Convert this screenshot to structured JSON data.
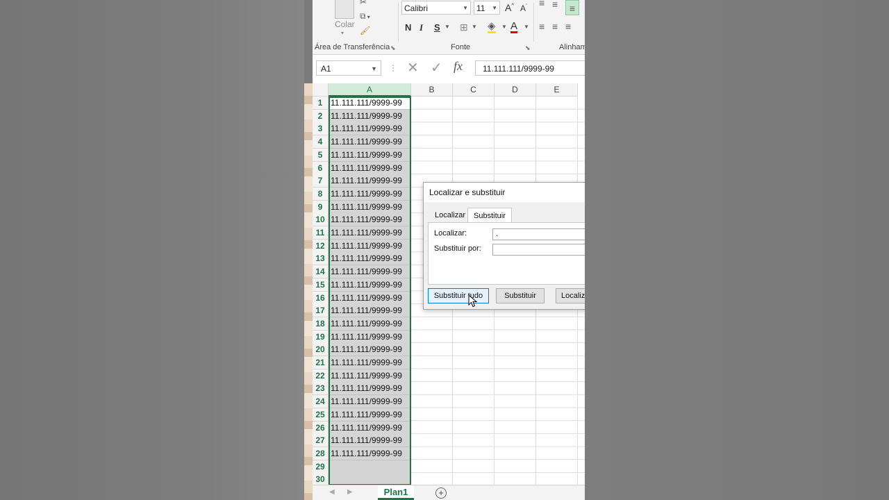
{
  "ribbon": {
    "paste_label": "Colar",
    "clipboard_group": "Área de Transferência",
    "font_group": "Fonte",
    "alignment_group": "Alinham",
    "font_name": "Calibri",
    "font_size": "11",
    "grow_font": "A",
    "shrink_font": "A",
    "bold": "N",
    "italic": "I",
    "underline": "S"
  },
  "formula_bar": {
    "name_box": "A1",
    "fx": "fx",
    "value": "11.111.111/9999-99"
  },
  "grid": {
    "columns": [
      "A",
      "B",
      "C",
      "D",
      "E"
    ],
    "rows": [
      "1",
      "2",
      "3",
      "4",
      "5",
      "6",
      "7",
      "8",
      "9",
      "10",
      "11",
      "12",
      "13",
      "14",
      "15",
      "16",
      "17",
      "18",
      "19",
      "20",
      "21",
      "22",
      "23",
      "24",
      "25",
      "26",
      "27",
      "28",
      "29",
      "30"
    ],
    "colA": [
      "11.111.111/9999-99",
      "11.111.111/9999-99",
      "11.111.111/9999-99",
      "11.111.111/9999-99",
      "11.111.111/9999-99",
      "11.111.111/9999-99",
      "11.111.111/9999-99",
      "11.111.111/9999-99",
      "11.111.111/9999-99",
      "11.111.111/9999-99",
      "11.111.111/9999-99",
      "11.111.111/9999-99",
      "11.111.111/9999-99",
      "11.111.111/9999-99",
      "11.111.111/9999-99",
      "11.111.111/9999-99",
      "11.111.111/9999-99",
      "11.111.111/9999-99",
      "11.111.111/9999-99",
      "11.111.111/9999-99",
      "11.111.111/9999-99",
      "11.111.111/9999-99",
      "11.111.111/9999-99",
      "11.111.111/9999-99",
      "11.111.111/9999-99",
      "11.111.111/9999-99",
      "11.111.111/9999-99",
      "11.111.111/9999-99",
      "",
      ""
    ]
  },
  "sheet_tab": "Plan1",
  "dialog": {
    "title": "Localizar e substituir",
    "tab_find": "Localizar",
    "tab_replace": "Substituir",
    "find_label": "Localizar:",
    "find_value": ".",
    "replace_label": "Substituir por:",
    "replace_value": "",
    "btn_replace_all": "Substituir tudo",
    "btn_replace": "Substituir",
    "btn_find": "Localizar"
  },
  "colors": {
    "excel_green": "#217346",
    "selection_gray": "#d4d4d4"
  }
}
